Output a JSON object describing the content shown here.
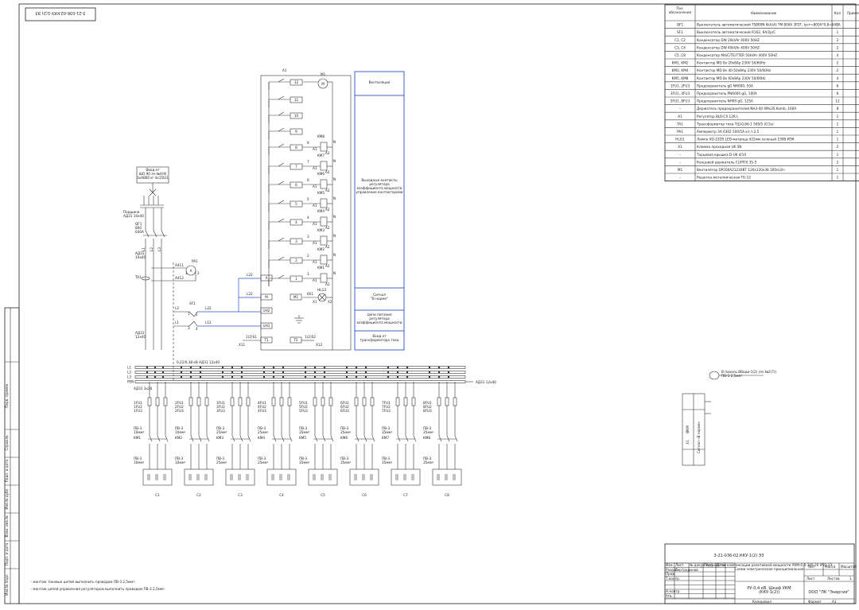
{
  "doc_code": "3-21-036-02.ККУ-1(2) ЭЗ",
  "doc_code_rotated": "3-21-036-02.ККУ-1(2) ЭЗ",
  "spec": {
    "headers": [
      "Поз. обозначение",
      "Наименование",
      "Кол",
      "Примечание"
    ],
    "rows": [
      [
        "QF1",
        "Выключатель автоматический TS800N 6kA(4) TM 800A 3P3T, Iуст=800A*0,8=640A",
        "1",
        ""
      ],
      [
        "SF1",
        "Выключатель автоматический R162, 6A/2p/C",
        "1",
        ""
      ],
      [
        "C1, C2",
        "Конденсатор DW 20kVAr 400V 50HZ",
        "2",
        ""
      ],
      [
        "C3, C4",
        "Конденсатор DW 40kVAr 400V 50HZ",
        "2",
        ""
      ],
      [
        "C5..C8",
        "Конденсатор MA/C/TE/7TER 50kVAr 400V 50HZ",
        "4",
        ""
      ],
      [
        "KM1, KM2",
        "Контактор MD 8x 20x8Ap 230V 50/60Hz",
        "2",
        ""
      ],
      [
        "KM3, KM4",
        "Контактор MD 8x 40-50x8Ap 230V 50/60Hz",
        "2",
        ""
      ],
      [
        "KM5..KM8",
        "Контактор MD 8x 60x8Ap 230V 50/60Hz",
        "4",
        ""
      ],
      [
        "1FU1..2FU3",
        "Предохранитель gG NH000, 50A",
        "6",
        ""
      ],
      [
        "3FU1..4FU3",
        "Предохранитель PNA000 gG, 100A",
        "6",
        ""
      ],
      [
        "5FU1..8FU3",
        "Предохранитель NH00 gG, 125A",
        "12",
        ""
      ],
      [
        "–",
        "Держатель предохранителей NH3-00 0Mx35 Komb. 160A",
        "8",
        ""
      ],
      [
        "A1",
        "Регулятор BLR-CX 12R L",
        "1",
        ""
      ],
      [
        "TA1",
        "Трансформатор тока TШ-0,66-1 500/5 (0,5s)",
        "1",
        ""
      ],
      [
        "PA1",
        "Амперметр ЗА 0302 500/5А кл.т.2,5",
        "1",
        ""
      ],
      [
        "HLG1",
        "Лампа AD-22DS LED-матрица d22мм зеленый 230В ИЭК",
        "1",
        ""
      ],
      [
        "X1",
        "Клемма проходная UK 5N",
        "2",
        ""
      ],
      [
        "–",
        "Торцевая крышка D-UK 4/10",
        "1",
        ""
      ],
      [
        "–",
        "Концевой держатель CLIPFIX 35-5",
        "2",
        ""
      ],
      [
        "M1",
        "Вентилятор DP200A2123XBT 120x120x38 165m3/ч",
        "1",
        ""
      ],
      [
        "–",
        "Решетка металлическая FG-12",
        "1",
        ""
      ]
    ]
  },
  "regulator": {
    "title": "A1",
    "motor": "M1",
    "boxes": [
      "Вентиляция",
      "Выходные контакты регулятора коэффициента мощности, управление контакторами",
      "Сигнал \"В норме\"",
      "Цепи питания регулятора коэффициента мощности",
      "Вход от трансформатора тока"
    ],
    "terminals": [
      "12",
      "11",
      "10",
      "9",
      "8",
      "7",
      "6",
      "5",
      "4",
      "3",
      "2",
      "1"
    ],
    "contactors": [
      "KM8",
      "KM7",
      "KM6",
      "KM5",
      "KM4",
      "KM3",
      "KM2",
      "KM1"
    ],
    "pins": [
      "A",
      "M",
      "UH2",
      "UH1",
      "T1",
      "T2",
      "M1",
      "A1",
      "A2",
      "N",
      "X1",
      "X2",
      "HLG1",
      "601"
    ],
    "wire_labels": [
      "L22",
      "L22",
      "L2",
      "L1",
      "L12",
      "1(2)S1",
      "1(2)S2",
      "X11",
      "X12",
      "L22",
      "L12"
    ]
  },
  "input": {
    "cable": "Ввод от ШО 90 яч.№4(9) 3xАВВГнг 4x150(1",
    "feeder_label": "Подшина\nАД31 10x40",
    "breaker": "QF1\n800\n640A",
    "bus_label": "АД31\n10x40",
    "ta": "TA1",
    "pa": "PA1",
    "sf": "SF1",
    "a411": "A411",
    "a412": "A412",
    "cable_bottom": "АД31\n12x40",
    "bus_note": "0,22/0,38 кВ АД31 12x40",
    "bus_phases": [
      "L1",
      "L2",
      "L3",
      "PEN"
    ],
    "bus_right": "АД31 12x40",
    "bus_left_label": "АД31 3x20"
  },
  "branches": [
    {
      "fu": "1FU1\n1FU2\n1FU3",
      "km": "KM1",
      "c": "C1",
      "wire": "ПВ-3\n10мм²"
    },
    {
      "fu": "2FU1\n2FU2\n2FU3",
      "km": "KM2",
      "c": "C2",
      "wire": "ПВ-3\n10мм²"
    },
    {
      "fu": "3FU1\n3FU2\n3FU3",
      "km": "KM3",
      "c": "C3",
      "wire": "ПВ-3\n25мм²"
    },
    {
      "fu": "4FU1\n4FU2\n4FU3",
      "km": "KM4",
      "c": "C4",
      "wire": "ПВ-3\n25мм²"
    },
    {
      "fu": "5FU1\n5FU2\n5FU3",
      "km": "KM5",
      "c": "C5",
      "wire": "ПВ-3\n35мм²"
    },
    {
      "fu": "6FU1\n6FU2\n6FU3",
      "km": "KM6",
      "c": "C6",
      "wire": "ПВ-3\n35мм²"
    },
    {
      "fu": "7FU1\n7FU2\n7FU3",
      "km": "KM7",
      "c": "C7",
      "wire": "ПВ-3\n35мм²"
    },
    {
      "fu": "8FU1\n8FU2\n8FU3",
      "km": "KM8",
      "c": "C8",
      "wire": "ПВ-3\n35мм²"
    }
  ],
  "terminal_block": {
    "signal": "В панель ВВоди-1(2) (яч.№2(7))\nПВ-3 2,5мм²",
    "label_x1": "X1",
    "label_vkm": "ВКМ",
    "label_sig": "Сигнал «В норме»"
  },
  "notes": [
    "– монтаж токовых цепей выполнить проводом ПВ-3 2,5мм²;",
    "– монтаж цепей управления регулятором выполнить проводом ПВ-3 2,5мм²."
  ],
  "left_stamp": [
    "Инв.№ подл.",
    "Подп. и дата",
    "Взам. инв.№",
    "Инв.№ дубл.",
    "Подп. и дата",
    "Справ.№",
    "Перв. примен."
  ],
  "title_block": {
    "code": "3-21-036-02.ККУ-1(2) ЭЗ",
    "desc": "Устройство компенсации реактивной мощности УКМ-0,4-320-20 IP21 У3\nСхема электрическая принципиальная",
    "name": "РУ-0,4 кВ. Шкаф УКМ\n(ККУ-1(2))",
    "org": "ООО \"ЛК \"Энергия\"",
    "lit": "Лит.",
    "mass": "Масса",
    "scale": "Масштаб",
    "sheet": "Лист",
    "sheets": "Листов",
    "sheets_num": "1",
    "rows": [
      "Изм. Лист",
      "№ докум.",
      "Подп.",
      "Дата",
      "Разраб.",
      "Пр. Гертрудинов",
      "Пров.",
      "Т.контр.",
      "Н.контр.",
      "Утв."
    ],
    "copied": "Копировал",
    "format": "Формат",
    "format_val": "A1"
  }
}
